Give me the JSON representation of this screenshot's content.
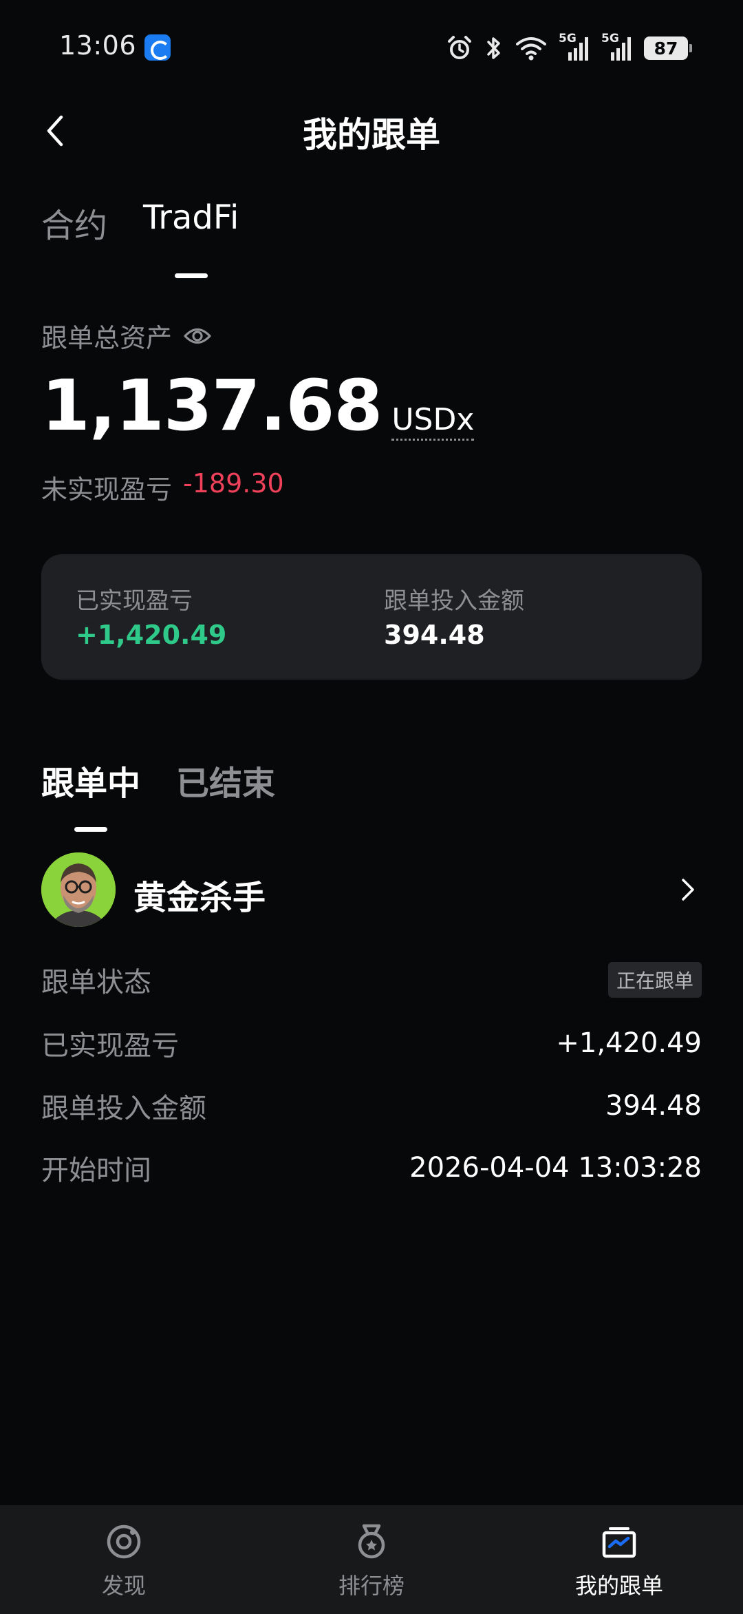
{
  "status_bar": {
    "time": "13:06",
    "net_label_1": "5G",
    "net_label_2": "5G",
    "battery": "87",
    "icons": [
      "app-notification-icon",
      "alarm-icon",
      "bluetooth-icon",
      "wifi-icon",
      "signal-5g-icon",
      "signal-5g-icon",
      "battery-icon"
    ]
  },
  "header": {
    "title": "我的跟单",
    "back_icon": "chevron-left-icon"
  },
  "top_tabs": [
    {
      "label": "合约",
      "active": false
    },
    {
      "label": "TradFi",
      "active": true
    }
  ],
  "summary": {
    "total_label": "跟单总资产",
    "eye_icon": "eye-icon",
    "total_amount": "1,137.68",
    "unit": "USDx",
    "unrealized_label": "未实现盈亏",
    "unrealized_value": "-189.30"
  },
  "card": {
    "realized_label": "已实现盈亏",
    "realized_value": "+1,420.49",
    "invested_label": "跟单投入金额",
    "invested_value": "394.48"
  },
  "list_tabs": [
    {
      "label": "跟单中",
      "active": true
    },
    {
      "label": "已结束",
      "active": false
    }
  ],
  "trader": {
    "name": "黄金杀手",
    "chevron_icon": "chevron-right-icon",
    "rows": {
      "status_label": "跟单状态",
      "status_value": "正在跟单",
      "realized_label": "已实现盈亏",
      "realized_value": "+1,420.49",
      "invested_label": "跟单投入金额",
      "invested_value": "394.48",
      "start_label": "开始时间",
      "start_value": "2026-04-04 13:03:28"
    }
  },
  "bottom_nav": [
    {
      "label": "发现",
      "icon": "discover-icon",
      "active": false
    },
    {
      "label": "排行榜",
      "icon": "leaderboard-medal-icon",
      "active": false
    },
    {
      "label": "我的跟单",
      "icon": "my-copy-trades-icon",
      "active": true
    }
  ],
  "colors": {
    "background": "#07080a",
    "card": "#1f2023",
    "positive": "#2fc98a",
    "negative": "#f0415b",
    "muted": "#8e8f93",
    "active_nav_accent": "#1a6cf5"
  }
}
